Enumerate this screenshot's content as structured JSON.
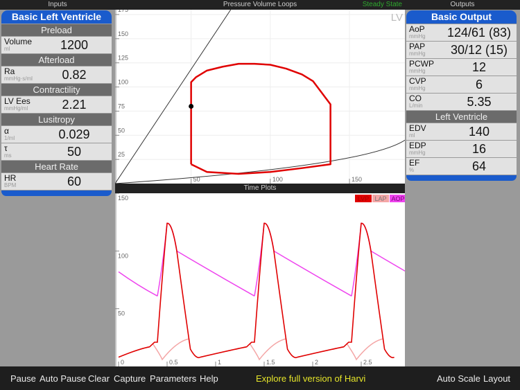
{
  "headers": {
    "inputs": "Inputs",
    "pv": "Pressure Volume Loops",
    "steady": "Steady State",
    "outputs": "Outputs",
    "time": "Time Plots"
  },
  "inputs": {
    "title": "Basic Left Ventricle",
    "sections": [
      {
        "name": "Preload",
        "rows": [
          {
            "label": "Volume",
            "unit": "ml",
            "value": "1200"
          }
        ]
      },
      {
        "name": "Afterload",
        "rows": [
          {
            "label": "Ra",
            "unit": "mmHg·s/ml",
            "value": "0.82"
          }
        ]
      },
      {
        "name": "Contractility",
        "rows": [
          {
            "label": "LV Ees",
            "unit": "mmHg/ml",
            "value": "2.21"
          }
        ]
      },
      {
        "name": "Lusitropy",
        "rows": [
          {
            "label": "α",
            "unit": "1/ml",
            "value": "0.029"
          },
          {
            "label": "τ",
            "unit": "ms",
            "value": "50"
          }
        ]
      },
      {
        "name": "Heart Rate",
        "rows": [
          {
            "label": "HR",
            "unit": "BPM",
            "value": "60"
          }
        ]
      }
    ]
  },
  "outputs": {
    "title": "Basic Output",
    "rows": [
      {
        "label": "AoP",
        "unit": "mmHg",
        "value": "124/61 (83)"
      },
      {
        "label": "PAP",
        "unit": "mmHg",
        "value": "30/12 (15)"
      },
      {
        "label": "PCWP",
        "unit": "mmHg",
        "value": "12"
      },
      {
        "label": "CVP",
        "unit": "mmHg",
        "value": "6"
      },
      {
        "label": "CO",
        "unit": "L/min",
        "value": "5.35"
      }
    ],
    "lv_title": "Left Ventricle",
    "lv_rows": [
      {
        "label": "EDV",
        "unit": "ml",
        "value": "140"
      },
      {
        "label": "EDP",
        "unit": "mmHg",
        "value": "16"
      },
      {
        "label": "EF",
        "unit": "%",
        "value": "64"
      }
    ]
  },
  "toolbar": {
    "left": [
      "Pause",
      "Auto Pause",
      "Clear",
      "Capture",
      "Parameters",
      "Help"
    ],
    "promo": "Explore full version of Harvi",
    "right": [
      "Auto Scale",
      "Layout"
    ]
  },
  "colors": {
    "blue": "#1a5bcc",
    "green": "#2ea82e",
    "promo": "#e6e62a",
    "lvp": "#e00000",
    "lap": "#f4a6a6",
    "aop": "#ee44ee"
  },
  "chart_data": [
    {
      "type": "line",
      "title": "Pressure Volume Loops",
      "label": "LV",
      "xlim": [
        2,
        185
      ],
      "ylim": [
        0,
        180
      ],
      "x_ticks": [
        50,
        100,
        150
      ],
      "y_ticks": [
        25,
        50,
        75,
        100,
        125,
        150,
        175
      ],
      "loop": {
        "x": [
          50,
          50,
          53,
          60,
          70,
          80,
          90,
          100,
          110,
          120,
          127,
          138,
          138,
          120,
          100,
          80,
          60,
          50
        ],
        "y": [
          20,
          105,
          110,
          117,
          121,
          124,
          124,
          123,
          119,
          113,
          106,
          82,
          20,
          16,
          12,
          10,
          12,
          20
        ]
      },
      "espvr": {
        "x": [
          2,
          75
        ],
        "y": [
          0,
          180
        ]
      },
      "edpvr": {
        "x": [
          2,
          160,
          185
        ],
        "y": [
          0,
          18,
          45
        ]
      },
      "marker": {
        "x": 50,
        "y": 80
      }
    },
    {
      "type": "line",
      "title": "Time Plots",
      "xlim": [
        0,
        2.95
      ],
      "ylim": [
        0,
        150
      ],
      "x_ticks": [
        0,
        0.5,
        1,
        1.5,
        2,
        2.5
      ],
      "y_ticks": [
        50,
        100,
        150
      ],
      "legend": [
        "LVP",
        "LAP",
        "AOP"
      ],
      "legend_position": "top-right"
    }
  ]
}
